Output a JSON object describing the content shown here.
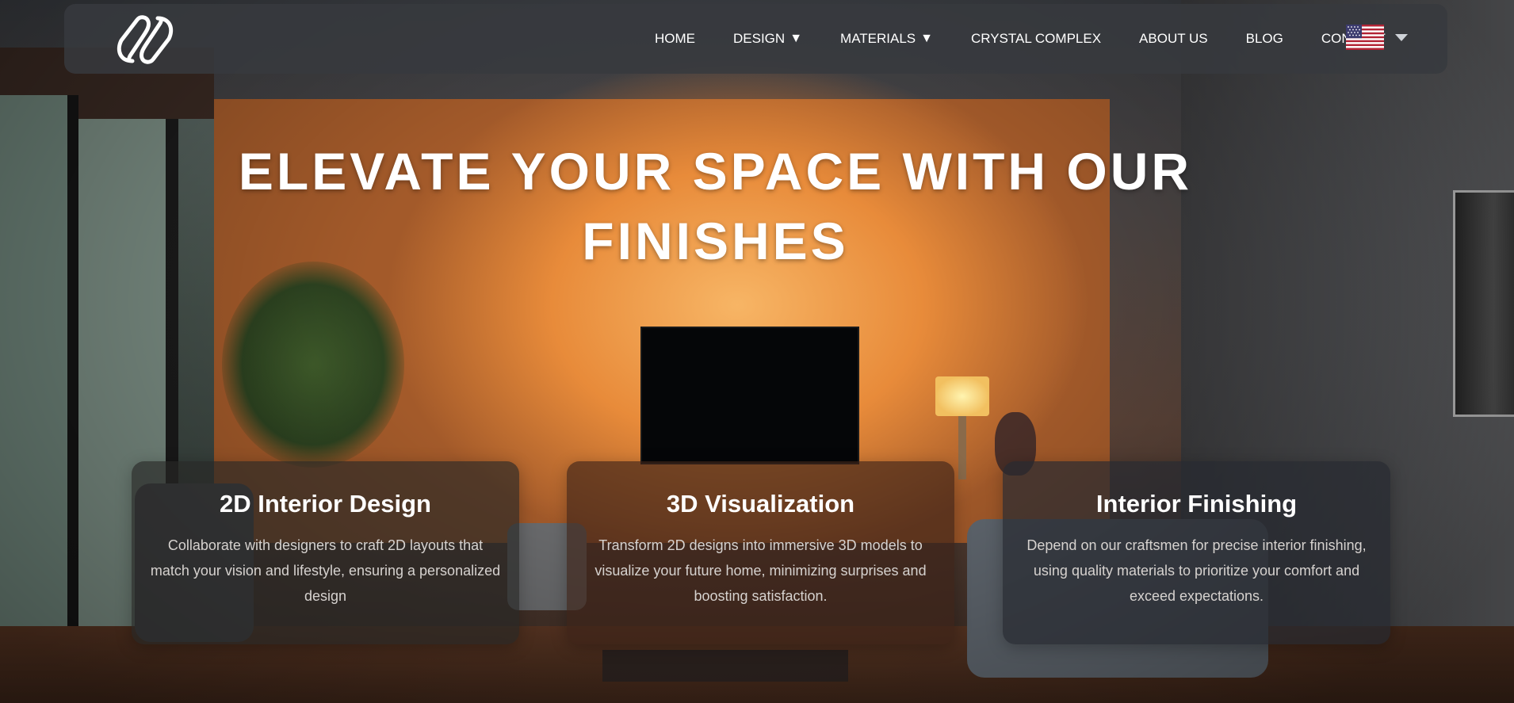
{
  "nav": {
    "logo": "logo-icon",
    "items": [
      {
        "label": "HOME",
        "dropdown": false
      },
      {
        "label": "DESIGN",
        "dropdown": true
      },
      {
        "label": "MATERIALS",
        "dropdown": true
      },
      {
        "label": "CRYSTAL COMPLEX",
        "dropdown": false
      },
      {
        "label": "ABOUT US",
        "dropdown": false
      },
      {
        "label": "BLOG",
        "dropdown": false
      },
      {
        "label": "CONTACT",
        "dropdown": false
      }
    ],
    "dropdown_caret": "▼",
    "language_icon": "us-flag-icon"
  },
  "hero": {
    "headline": "ELEVATE YOUR SPACE WITH OUR FINISHES"
  },
  "cards": [
    {
      "title": "2D Interior Design",
      "description": "Collaborate with designers to craft 2D layouts that match your vision and lifestyle, ensuring a personalized design"
    },
    {
      "title": "3D Visualization",
      "description": "Transform 2D designs into immersive 3D models to visualize your future home, minimizing surprises and boosting satisfaction."
    },
    {
      "title": "Interior Finishing",
      "description": "Depend on our craftsmen for precise interior finishing, using quality materials to prioritize your comfort and exceed expectations."
    }
  ],
  "colors": {
    "navbar_bg": "#373a3e",
    "text": "#ffffff",
    "card_text": "#d6d2cf",
    "accent_warm": "#e88b3a"
  }
}
